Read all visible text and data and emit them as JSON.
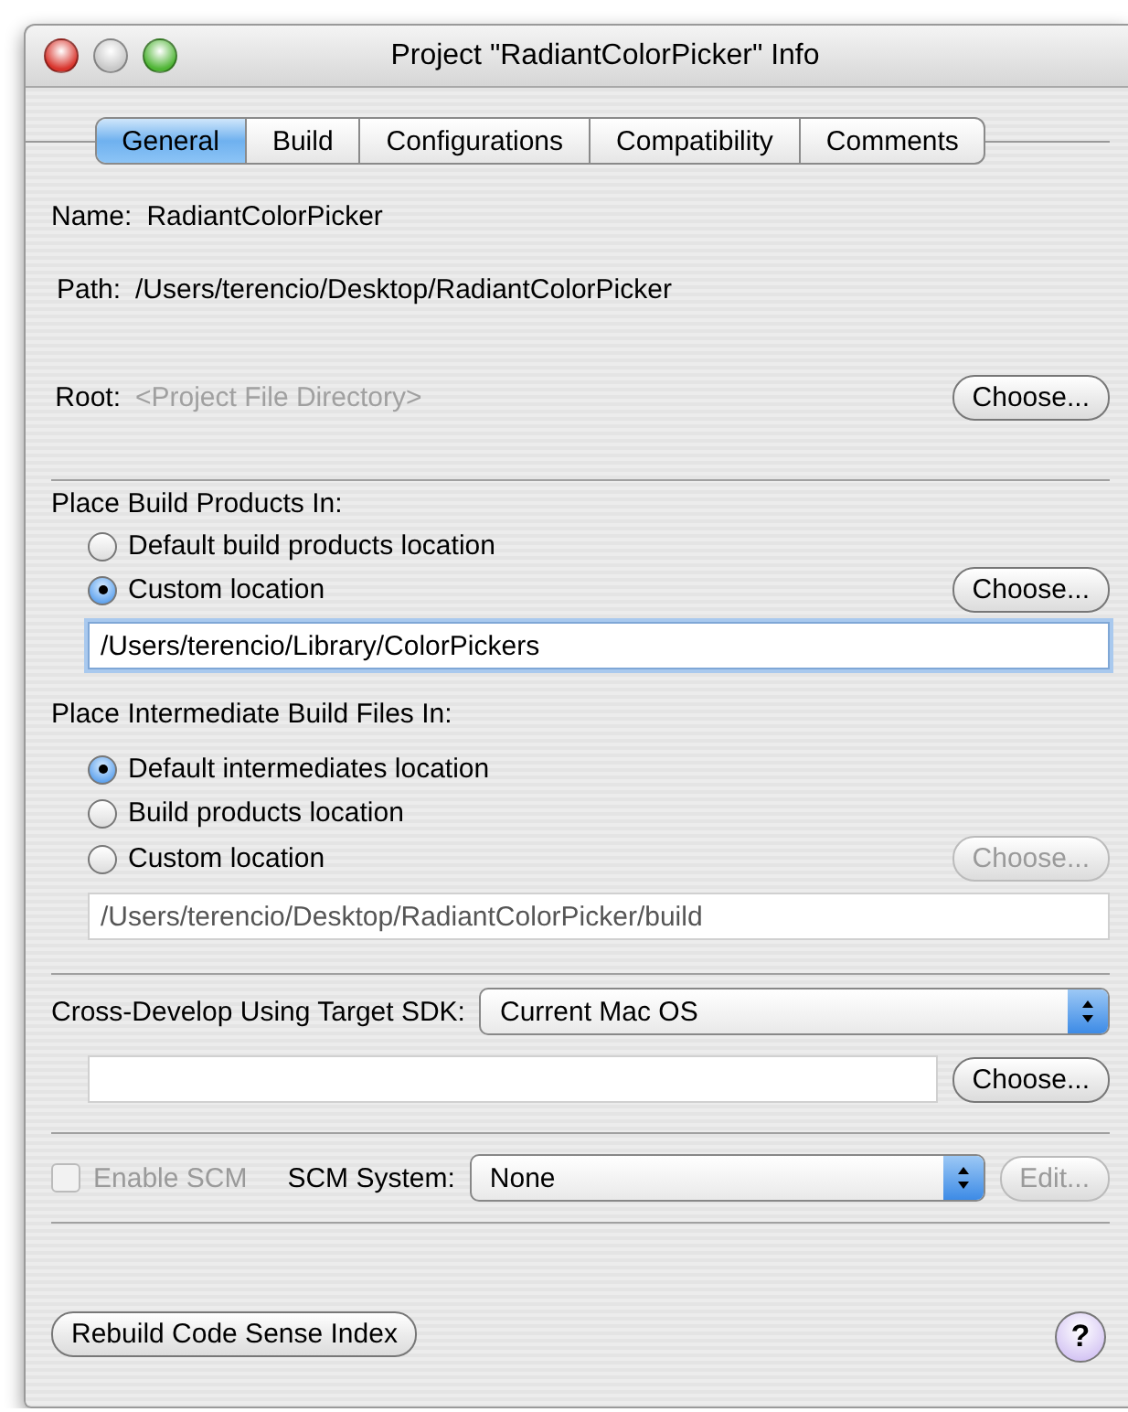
{
  "window": {
    "title": "Project \"RadiantColorPicker\" Info"
  },
  "tabs": [
    {
      "label": "General",
      "selected": true
    },
    {
      "label": "Build",
      "selected": false
    },
    {
      "label": "Configurations",
      "selected": false
    },
    {
      "label": "Compatibility",
      "selected": false
    },
    {
      "label": "Comments",
      "selected": false
    }
  ],
  "name": {
    "label": "Name:",
    "value": "RadiantColorPicker"
  },
  "path": {
    "label": "Path:",
    "value": "/Users/terencio/Desktop/RadiantColorPicker"
  },
  "root": {
    "label": "Root:",
    "placeholder": "<Project File Directory>",
    "button": {
      "label": "Choose...",
      "disabled": false
    }
  },
  "build_products": {
    "heading": "Place Build Products In:",
    "options": [
      {
        "label": "Default build products location",
        "selected": false
      },
      {
        "label": "Custom location",
        "selected": true
      }
    ],
    "button": {
      "label": "Choose...",
      "disabled": false
    },
    "field": {
      "value": "/Users/terencio/Library/ColorPickers",
      "focused": true
    }
  },
  "intermediates": {
    "heading": "Place Intermediate Build Files In:",
    "options": [
      {
        "label": "Default intermediates location",
        "selected": true
      },
      {
        "label": "Build products location",
        "selected": false
      },
      {
        "label": "Custom location",
        "selected": false
      }
    ],
    "button": {
      "label": "Choose...",
      "disabled": true
    },
    "field": {
      "value": "/Users/terencio/Desktop/RadiantColorPicker/build",
      "focused": false
    }
  },
  "cross_develop": {
    "label": "Cross-Develop Using Target SDK:",
    "select": "Current Mac OS",
    "button": {
      "label": "Choose...",
      "disabled": false
    }
  },
  "scm": {
    "enable_label": "Enable SCM",
    "checked": false,
    "disabled": true,
    "system_label": "SCM System:",
    "select": "None",
    "button": {
      "label": "Edit...",
      "disabled": true
    }
  },
  "rebuild_button": {
    "label": "Rebuild Code Sense Index",
    "disabled": false
  },
  "help_button": {
    "label": "?"
  }
}
